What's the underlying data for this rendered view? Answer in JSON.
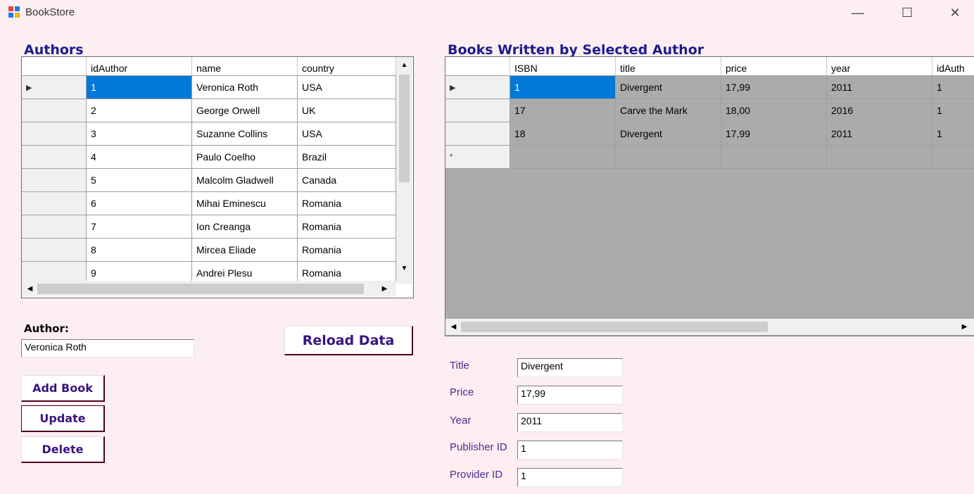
{
  "window": {
    "title": "BookStore",
    "minimize": "—",
    "maximize": "☐",
    "close": "✕"
  },
  "authors": {
    "title": "Authors",
    "columns": [
      "idAuthor",
      "name",
      "country"
    ],
    "rows": [
      [
        "1",
        "Veronica Roth",
        "USA"
      ],
      [
        "2",
        "George Orwell",
        "UK"
      ],
      [
        "3",
        "Suzanne Collins",
        "USA"
      ],
      [
        "4",
        "Paulo Coelho",
        "Brazil"
      ],
      [
        "5",
        "Malcolm Gladwell",
        "Canada"
      ],
      [
        "6",
        "Mihai Eminescu",
        "Romania"
      ],
      [
        "7",
        "Ion Creanga",
        "Romania"
      ],
      [
        "8",
        "Mircea Eliade",
        "Romania"
      ],
      [
        "9",
        "Andrei Plesu",
        "Romania"
      ]
    ],
    "current_row_marker": "▶"
  },
  "books": {
    "title": "Books Written by Selected Author",
    "columns": [
      "ISBN",
      "title",
      "price",
      "year",
      "idAuth"
    ],
    "rows": [
      [
        "1",
        "Divergent",
        "17,99",
        "2011",
        "1"
      ],
      [
        "17",
        "Carve the Mark",
        "18,00",
        "2016",
        "1"
      ],
      [
        "18",
        "Divergent",
        "17,99",
        "2011",
        "1"
      ]
    ],
    "current_row_marker": "▶",
    "new_row_marker": "*"
  },
  "author_field": {
    "label": "Author:",
    "value": "Veronica Roth"
  },
  "buttons": {
    "reload": "Reload Data",
    "add_book": "Add Book",
    "update": "Update",
    "delete": "Delete"
  },
  "form": {
    "title_label": "Title",
    "title_value": "Divergent",
    "price_label": "Price",
    "price_value": "17,99",
    "year_label": "Year",
    "year_value": "2011",
    "publisher_label": "Publisher ID",
    "publisher_value": "1",
    "provider_label": "Provider ID",
    "provider_value": "1"
  }
}
